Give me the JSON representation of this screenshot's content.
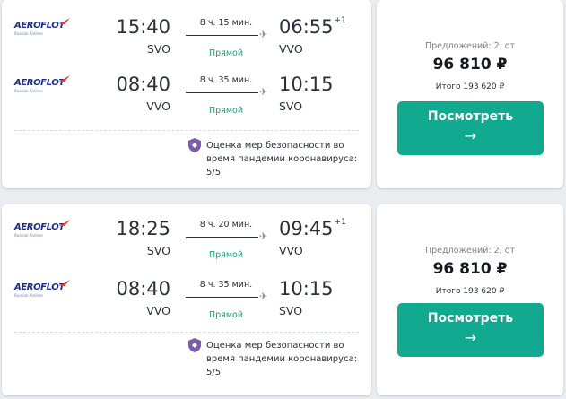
{
  "cards": [
    {
      "segments": [
        {
          "airline": "AEROFLOT",
          "airline_sub": "Russian Airlines",
          "dep_time": "15:40",
          "dep_code": "SVO",
          "duration": "8 ч. 15 мин.",
          "direct": "Прямой",
          "arr_time": "06:55",
          "arr_plus": "+1",
          "arr_code": "VVO"
        },
        {
          "airline": "AEROFLOT",
          "airline_sub": "Russian Airlines",
          "dep_time": "08:40",
          "dep_code": "VVO",
          "duration": "8 ч. 35 мин.",
          "direct": "Прямой",
          "arr_time": "10:15",
          "arr_plus": "",
          "arr_code": "SVO"
        }
      ],
      "safety": [
        "Оценка мер безопасности во",
        "время пандемии коронавируса:",
        "5/5"
      ],
      "offers": "Предложений: 2, от",
      "price": "96 810 ₽",
      "total": "Итого 193 620 ₽",
      "button_label": "Посмотреть",
      "button_arrow": "→"
    },
    {
      "segments": [
        {
          "airline": "AEROFLOT",
          "airline_sub": "Russian Airlines",
          "dep_time": "18:25",
          "dep_code": "SVO",
          "duration": "8 ч. 20 мин.",
          "direct": "Прямой",
          "arr_time": "09:45",
          "arr_plus": "+1",
          "arr_code": "VVO"
        },
        {
          "airline": "AEROFLOT",
          "airline_sub": "Russian Airlines",
          "dep_time": "08:40",
          "dep_code": "VVO",
          "duration": "8 ч. 35 мин.",
          "direct": "Прямой",
          "arr_time": "10:15",
          "arr_plus": "",
          "arr_code": "SVO"
        }
      ],
      "safety": [
        "Оценка мер безопасности во",
        "время пандемии коронавируса:",
        "5/5"
      ],
      "offers": "Предложений: 2, от",
      "price": "96 810 ₽",
      "total": "Итого 193 620 ₽",
      "button_label": "Посмотреть",
      "button_arrow": "→"
    }
  ],
  "colors": {
    "accent": "#11a990",
    "direct": "#1aa37a",
    "shield": "#7b5ea7",
    "airline": "#1c2f80",
    "airline_wing": "#e5422d"
  },
  "icons": {
    "plane": "plane-icon",
    "shield": "shield-icon",
    "arrow": "arrow-right-icon"
  }
}
